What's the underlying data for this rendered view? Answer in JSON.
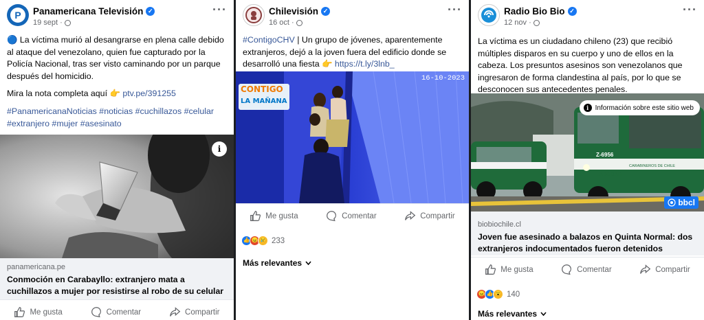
{
  "posts": [
    {
      "page_name": "Panamericana Televisión",
      "date": "19 sept · ",
      "text_p1": "🔵 La víctima murió al desangrarse en plena calle debido al ataque del venezolano, quien fue capturado por la Policía Nacional, tras ser visto caminando por un parque después del homicidio.",
      "text_p2_prefix": "Mira la nota completa aquí 👉 ",
      "text_p2_link": "ptv.pe/391255",
      "hashtags": "#PanamericanaNoticias #noticias #cuchillazos #celular #extranjero #mujer #asesinato",
      "link_domain": "panamericana.pe",
      "link_title": "Conmoción en Carabayllo: extranjero mata a cuchillazos a mujer por resistirse al robo de su celular",
      "actions": {
        "like": "Me gusta",
        "comment": "Comentar",
        "share": "Compartir"
      }
    },
    {
      "page_name": "Chilevisión",
      "date": "16 oct · ",
      "text_hashtag": "#ContigoCHV",
      "text_body": " | Un grupo de jóvenes, aparentemente extranjeros, dejó a la joven fuera del edificio donde se desarrolló una fiesta 👉 ",
      "text_link": "https://t.ly/3lnb_",
      "video_logo_line1": "CONTIGO",
      "video_logo_line2": "LA MAÑANA",
      "video_timestamp": "16-10-2023",
      "actions": {
        "like": "Me gusta",
        "comment": "Comentar",
        "share": "Compartir"
      },
      "reaction_count": "233",
      "sort_label": "Más relevantes"
    },
    {
      "page_name": "Radio Bio Bio",
      "date": "12 nov · ",
      "text_p1": "La víctima es un ciudadano chileno (23) que recibió múltiples disparos en su cuerpo y uno de ellos en la cabeza. Los presuntos asesinos son venezolanos que ingresaron de forma clandestina al país, por lo que se desconocen sus antecedentes penales.",
      "info_label": "Información sobre este sitio web",
      "van_label_1": "CARABINEROS DE CHILE",
      "van_label_2": "Z-6956",
      "van_label_3": "LABOCAR",
      "brand_badge": "bbcl",
      "link_domain": "biobiochile.cl",
      "link_title": "Joven fue asesinado a balazos en Quinta Normal: dos extranjeros indocumentados fueron detenidos",
      "actions": {
        "like": "Me gusta",
        "comment": "Comentar",
        "share": "Compartir"
      },
      "reaction_count": "140",
      "sort_label": "Más relevantes"
    }
  ],
  "colors": {
    "facebook_blue": "#1877f2",
    "link": "#385898",
    "muted": "#65676b",
    "panel": "#f0f2f5"
  }
}
